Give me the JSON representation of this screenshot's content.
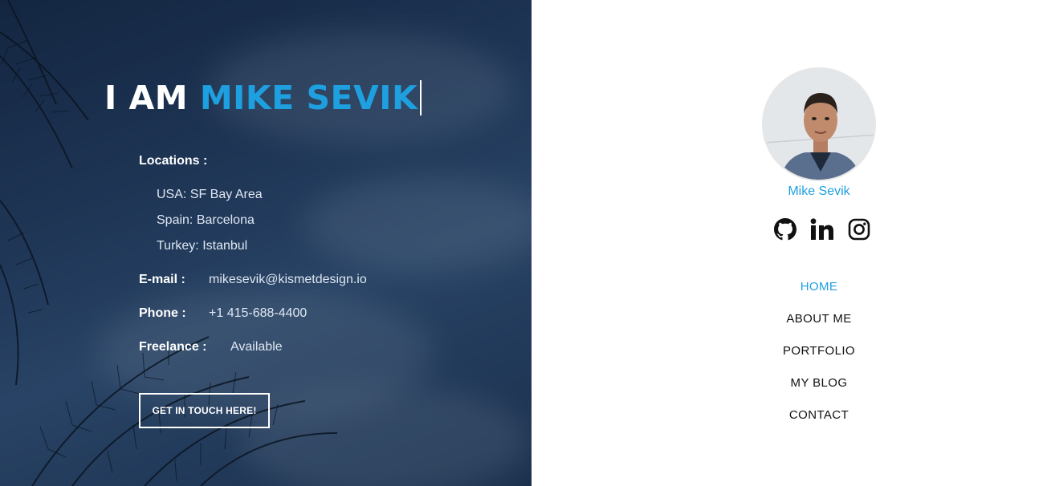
{
  "hero": {
    "greeting": "I AM",
    "name": "MIKE SEVIK",
    "locations_label": "Locations :",
    "locations": [
      "USA: SF Bay Area",
      "Spain: Barcelona",
      "Turkey: Istanbul"
    ],
    "email_label": "E-mail :",
    "email": "mikesevik@kismetdesign.io",
    "phone_label": "Phone :",
    "phone": "+1 415-688-4400",
    "freelance_label": "Freelance :",
    "freelance": "Available",
    "cta_label": "GET IN TOUCH HERE!"
  },
  "sidebar": {
    "profile_name": "Mike Sevik",
    "social": [
      "github-icon",
      "linkedin-icon",
      "instagram-icon"
    ],
    "nav": [
      {
        "label": "HOME",
        "active": true
      },
      {
        "label": "ABOUT ME",
        "active": false
      },
      {
        "label": "PORTFOLIO",
        "active": false
      },
      {
        "label": "MY BLOG",
        "active": false
      },
      {
        "label": "CONTACT",
        "active": false
      }
    ]
  },
  "colors": {
    "accent": "#1e9fe0",
    "text_dark": "#111111",
    "hero_bg": "#2a4468"
  }
}
